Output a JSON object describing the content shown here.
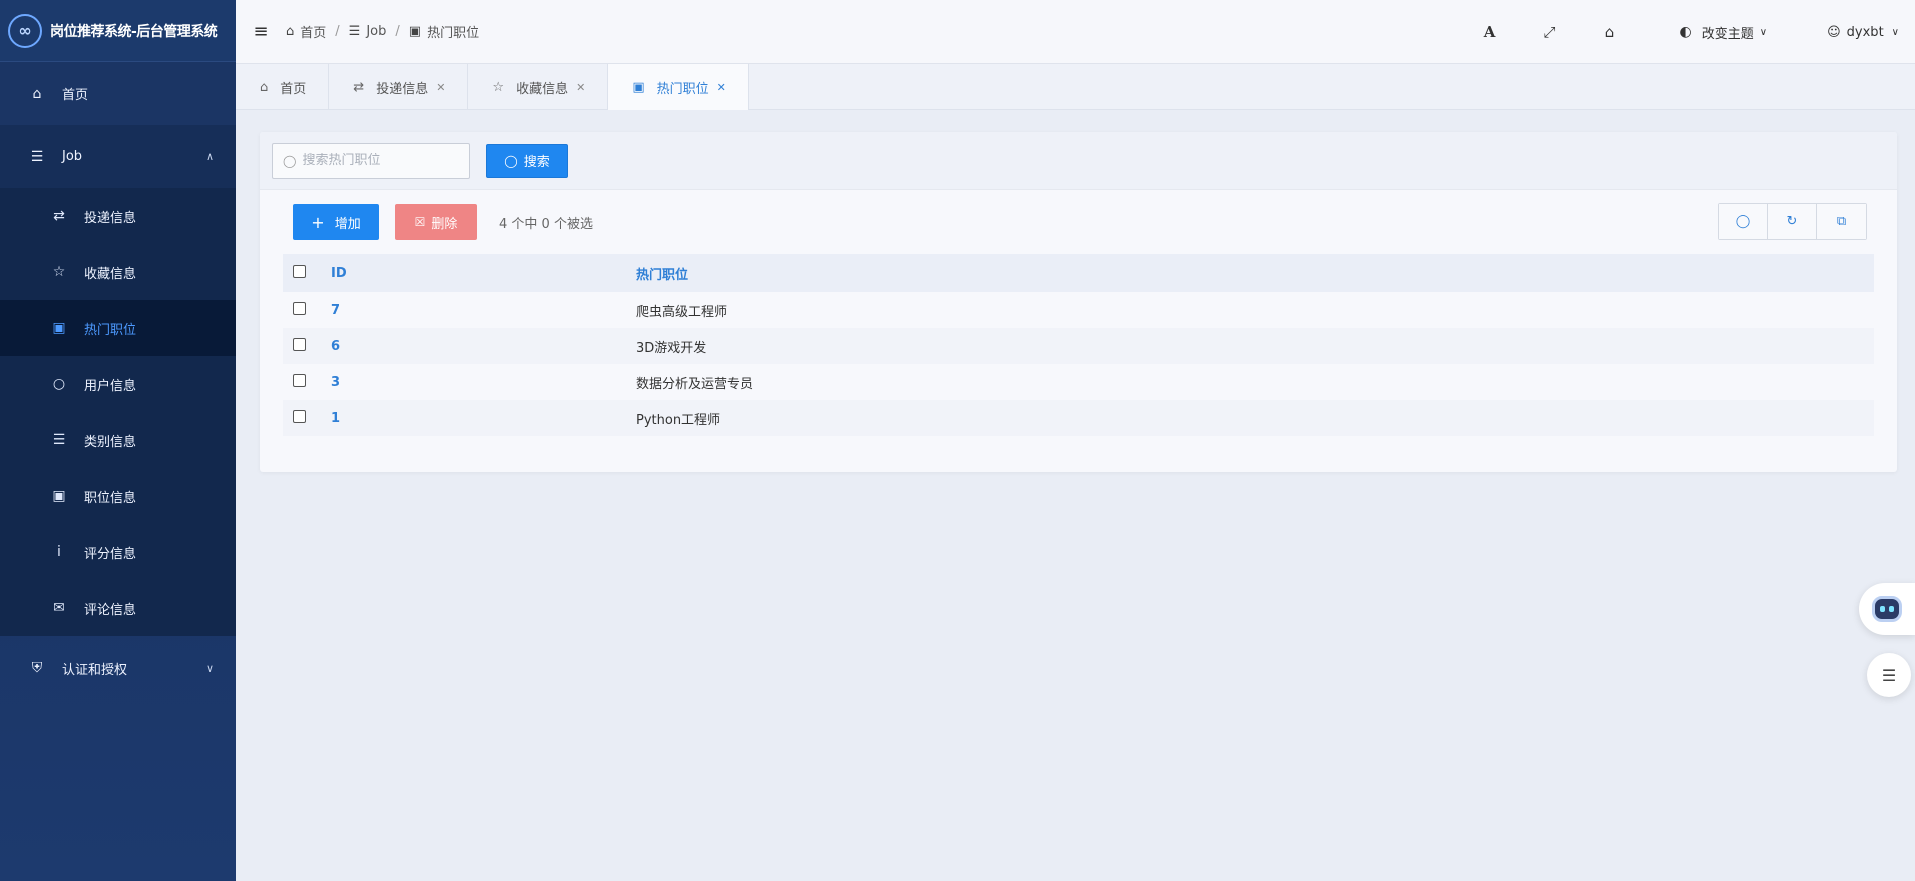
{
  "app": {
    "logo_glyph": "∞",
    "title": "岗位推荐系统-后台管理系统"
  },
  "sidebar": {
    "home": {
      "label": "首页",
      "icon": "home-icon"
    },
    "job_group": {
      "label": "Job",
      "icon": "list-icon",
      "expanded": true
    },
    "job_items": [
      {
        "label": "投递信息",
        "icon": "retweet-icon",
        "active": false
      },
      {
        "label": "收藏信息",
        "icon": "star-icon",
        "active": false
      },
      {
        "label": "热门职位",
        "icon": "id-card-icon",
        "active": true
      },
      {
        "label": "用户信息",
        "icon": "user-icon",
        "active": false
      },
      {
        "label": "类别信息",
        "icon": "list-icon",
        "active": false
      },
      {
        "label": "职位信息",
        "icon": "id-card-icon",
        "active": false
      },
      {
        "label": "评分信息",
        "icon": "info-icon",
        "active": false
      },
      {
        "label": "评论信息",
        "icon": "comments-icon",
        "active": false
      }
    ],
    "auth_group": {
      "label": "认证和授权",
      "icon": "shield-icon",
      "expanded": false
    }
  },
  "header": {
    "breadcrumb": [
      "首页",
      "Job",
      "热门职位"
    ],
    "theme_label": "改变主题",
    "username": "dyxbt"
  },
  "tabs": [
    {
      "label": "首页",
      "closable": false,
      "active": false
    },
    {
      "label": "投递信息",
      "closable": true,
      "active": false
    },
    {
      "label": "收藏信息",
      "closable": true,
      "active": false
    },
    {
      "label": "热门职位",
      "closable": true,
      "active": true
    }
  ],
  "search": {
    "placeholder": "搜索热门职位",
    "value": "",
    "button_label": "搜索"
  },
  "toolbar": {
    "add_label": "增加",
    "delete_label": "删除",
    "selection_text": "4 个中 0 个被选"
  },
  "table": {
    "columns": [
      "ID",
      "热门职位"
    ],
    "rows": [
      {
        "id": "7",
        "name": "爬虫高级工程师"
      },
      {
        "id": "6",
        "name": "3D游戏开发"
      },
      {
        "id": "3",
        "name": "数据分析及运营专员"
      },
      {
        "id": "1",
        "name": "Python工程师"
      }
    ]
  },
  "colors": {
    "primary": "#1f87f0",
    "danger": "#ef8585",
    "sidebar_bg": "#17305c",
    "active_text": "#4d9aff"
  }
}
